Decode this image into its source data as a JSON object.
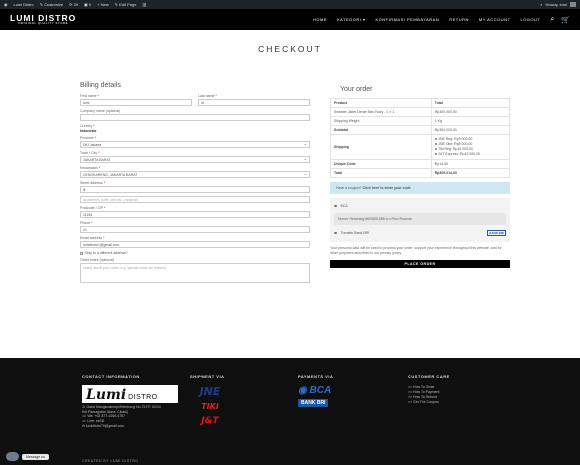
{
  "adminbar": {
    "items": [
      "Lumi Distro",
      "Customize",
      "29",
      "0",
      "+ New",
      "Edit Page",
      ""
    ],
    "greeting": "Howdy, lumi"
  },
  "header": {
    "logo_name": "LUMI DISTRO",
    "logo_tag": "ORIGINAL QUALITY STORE",
    "nav": [
      "HOME",
      "KATEGORI",
      "KONFIRMASI PEMBAYARAN",
      "RETURN",
      "MY ACCOUNT",
      "LOGOUT"
    ]
  },
  "page_title": "CHECKOUT",
  "billing": {
    "heading": "Billing details",
    "first_name_label": "First name",
    "first_name": "lumi",
    "last_name_label": "Last name",
    "last_name": "id",
    "company_label": "Company name (optional)",
    "country_label": "Country",
    "country": "Indonesia",
    "province_label": "Province",
    "province": "DKI Jakarta",
    "city_label": "Town / City",
    "city": "JAKARTA BARAT",
    "district_label": "Kecamatan",
    "district": "CENGKARENG, JAKARTA BARAT",
    "street_label": "Street address",
    "street": "lli",
    "street2_placeholder": "Apartment, suite, unit etc. (optional)",
    "postcode_label": "Postcode / ZIP",
    "postcode": "11153",
    "phone_label": "Phone",
    "phone": "41",
    "email_label": "Email address",
    "email": "lumidistro1@gmail.com",
    "ship_diff": "Ship to a different address?",
    "notes_label": "Order notes (optional)",
    "notes_placeholder": "Notes about your order, e.g. special notes for delivery."
  },
  "order": {
    "heading": "Your order",
    "col_product": "Product",
    "col_total": "Total",
    "product_name": "Sweater Jaket Denim Biru Navy - L × 1",
    "product_total": "Rp300.000,00",
    "weight_label": "Shipping Weight",
    "weight": "1 Kg",
    "subtotal_label": "Subtotal",
    "subtotal": "Rp300.000,00",
    "shipping_label": "Shipping",
    "shipping_options": [
      "JNE Reg: Rp9.000,00",
      "JNE Oke: Rp8.000,00",
      "Tiki Reg: Rp10.000,00",
      "J&T Express: Rp10.000,00"
    ],
    "unique_label": "Unique Code",
    "unique": "Rp14,00",
    "total_label": "Total",
    "total": "Rp309.014,00",
    "coupon_text": "Have a coupon?",
    "coupon_link": "Click here to enter your code",
    "pay_bca": "BCA",
    "bca_desc": "Nomor Rekening 8600801088 a.n Rico Ruanda",
    "pay_bri": "Transfer Bank BRI",
    "bri_logo": "BANK BRI",
    "privacy": "Your personal data will be used to process your order, support your experience throughout this website, and for other purposes described in our privacy policy.",
    "place_order": "PLACE ORDER"
  },
  "footer": {
    "contact_heading": "CONTACT INFORMATION",
    "brand_big": "Lumi",
    "brand_small": "DISTRO",
    "address": "Jl. Gatot Mangkuatmojo/Hembong No.75 RT 02/04 Kel.Pamagalan Utara, Cikatuj",
    "contacts": [
      "Wa: +62 877-1065-4767",
      "Line: csSD",
      "lumidistro79@gmail.com"
    ],
    "shipment_heading": "SHIPMENT VIA",
    "ship_logos": [
      "JNE",
      "TIKI",
      "J&T"
    ],
    "payments_heading": "PAYMENTS VIA",
    "pay_logos": [
      "BCA",
      "BANK BRI"
    ],
    "care_heading": "CUSTOMER CARE",
    "care_links": [
      ">> How To Order",
      ">> How To Payment",
      ">> How To Refund",
      ">> Get The Coupon"
    ],
    "bottom": "CREATED BY LUMI DISTRO",
    "message_label": "Message us"
  }
}
